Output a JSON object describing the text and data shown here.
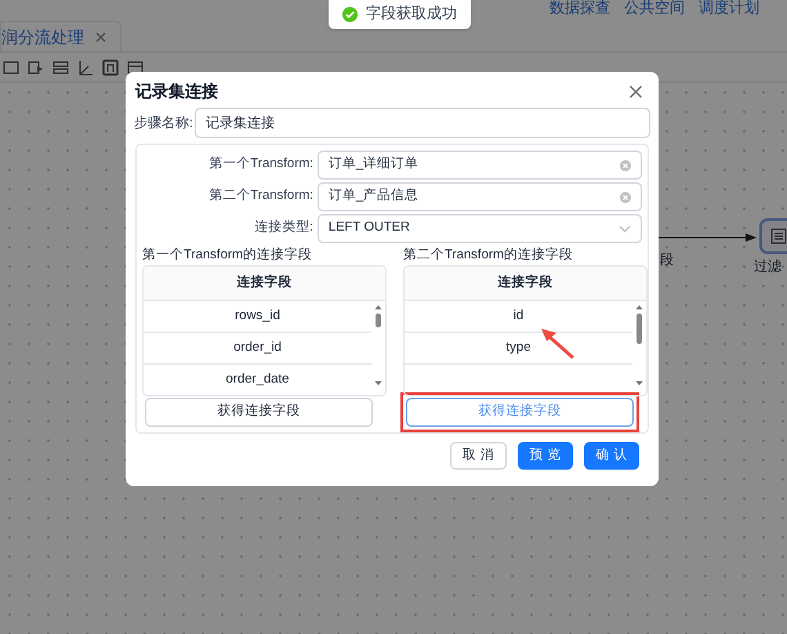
{
  "top_nav": [
    "数据探查",
    "公共空间",
    "调度计划"
  ],
  "tab": {
    "label": "润分流处理",
    "selected": true
  },
  "canvas": {
    "edge_label": "段",
    "node_label": "过滤"
  },
  "toast": {
    "kind": "success",
    "message": "字段获取成功"
  },
  "dialog": {
    "title": "记录集连接",
    "step_name": {
      "label": "步骤名称:",
      "value": "记录集连接"
    },
    "fields": [
      {
        "kind": "input",
        "label": "第一个Transform:",
        "value": "订单_详细订单"
      },
      {
        "kind": "input",
        "label": "第二个Transform:",
        "value": "订单_产品信息"
      },
      {
        "kind": "select",
        "label": "连接类型:",
        "value": "LEFT OUTER"
      }
    ],
    "join_tables": [
      {
        "title": "第一个Transform的连接字段",
        "column": "连接字段",
        "rows": [
          "rows_id",
          "order_id",
          "order_date"
        ],
        "button": "获得连接字段",
        "highlighted": false
      },
      {
        "title": "第二个Transform的连接字段",
        "column": "连接字段",
        "rows": [
          "id",
          "type"
        ],
        "button": "获得连接字段",
        "highlighted": true
      }
    ],
    "buttons": [
      {
        "label": "取 消",
        "kind": "default"
      },
      {
        "label": "预 览",
        "kind": "primary"
      },
      {
        "label": "确 认",
        "kind": "primary"
      }
    ]
  }
}
